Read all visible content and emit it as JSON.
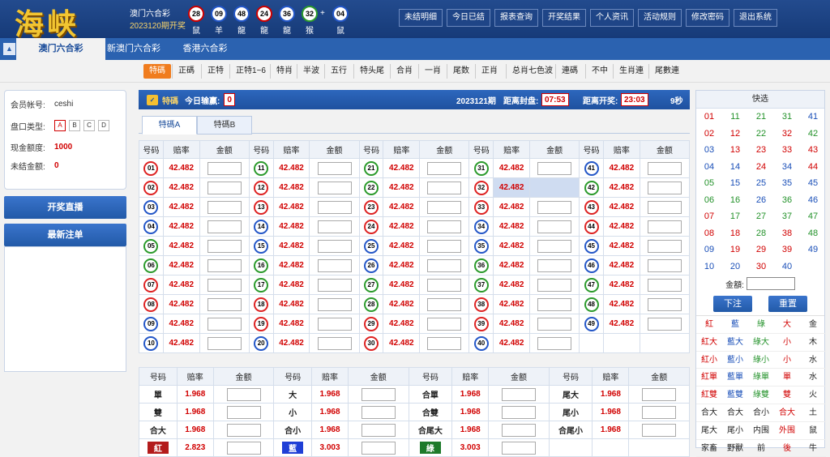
{
  "header": {
    "logo": "海峡",
    "lottery": "澳门六合彩",
    "issue": "2023120期开奖",
    "plus": "+",
    "balls": [
      {
        "n": "28",
        "z": "鼠",
        "c": "r"
      },
      {
        "n": "09",
        "z": "羊",
        "c": "u"
      },
      {
        "n": "48",
        "z": "龍",
        "c": "u"
      },
      {
        "n": "24",
        "z": "龍",
        "c": "r"
      },
      {
        "n": "36",
        "z": "龍",
        "c": "u"
      },
      {
        "n": "32",
        "z": "猴",
        "c": "g"
      },
      {
        "n": "04",
        "z": "鼠",
        "c": "u"
      }
    ],
    "nav": [
      "未结明细",
      "今日已结",
      "报表查询",
      "开奖结果",
      "个人资讯",
      "活动规则",
      "修改密码",
      "退出系统"
    ]
  },
  "tabs": [
    "澳门六合彩",
    "新澳门六合彩",
    "香港六合彩"
  ],
  "subnav": [
    "特碼",
    "正碼",
    "正特",
    "正特1~6",
    "特肖",
    "半波",
    "五行",
    "特头尾",
    "合肖",
    "一肖",
    "尾数",
    "正肖",
    "总肖七色波",
    "連碼",
    "不中",
    "生肖連",
    "尾數連"
  ],
  "account": {
    "user_label": "会员帐号:",
    "user": "ceshi",
    "pan_label": "盘口类型:",
    "pans": [
      "A",
      "B",
      "C",
      "D"
    ],
    "cash_label": "现金额度:",
    "cash": "1000",
    "unsettled_label": "未结金额:",
    "unsettled": "0"
  },
  "sidebar": {
    "live": "开奖直播",
    "latest": "最新注单"
  },
  "info": {
    "title": "特碼",
    "today_label": "今日输赢:",
    "today": "0",
    "period": "2023121期",
    "close_label": "距离封盘:",
    "close": "07:53",
    "open_label": "距离开奖:",
    "open": "23:03",
    "refresh": "9秒"
  },
  "subtabs": [
    "特碼A",
    "特碼B"
  ],
  "grid": {
    "h_num": "号码",
    "h_odds": "赔率",
    "h_amt": "金额",
    "odds": "42.482",
    "colors": [
      "r",
      "r",
      "u",
      "u",
      "g",
      "g",
      "r",
      "r",
      "u",
      "u",
      "g",
      "r",
      "r",
      "u",
      "u",
      "g",
      "g",
      "r",
      "r",
      "u",
      "g",
      "g",
      "r",
      "r",
      "u",
      "u",
      "g",
      "g",
      "r",
      "r",
      "g",
      "r",
      "r",
      "u",
      "u",
      "g",
      "g",
      "r",
      "r",
      "u",
      "u",
      "g",
      "r",
      "r",
      "u",
      "u",
      "g",
      "g",
      "u"
    ]
  },
  "grid2": {
    "rows": [
      [
        "單",
        "1.968",
        "大",
        "1.968",
        "合單",
        "1.968",
        "尾大",
        "1.968"
      ],
      [
        "雙",
        "1.968",
        "小",
        "1.968",
        "合雙",
        "1.968",
        "尾小",
        "1.968"
      ],
      [
        "合大",
        "1.968",
        "合小",
        "1.968",
        "合尾大",
        "1.968",
        "合尾小",
        "1.968"
      ],
      [
        "紅",
        "2.823",
        "藍",
        "3.003",
        "綠",
        "3.003",
        "",
        ""
      ]
    ]
  },
  "quick": {
    "title": "快选",
    "amount_label": "金額:",
    "submit": "下注",
    "reset": "重置",
    "zodiac": [
      [
        "紅",
        "藍",
        "綠",
        "大",
        "金"
      ],
      [
        "紅大",
        "藍大",
        "綠大",
        "小",
        "木"
      ],
      [
        "紅小",
        "藍小",
        "綠小",
        "小",
        "水"
      ],
      [
        "紅單",
        "藍單",
        "綠單",
        "單",
        "水"
      ],
      [
        "紅雙",
        "藍雙",
        "綠雙",
        "雙",
        "火"
      ],
      [
        "合大",
        "合大",
        "合小",
        "合大",
        "土"
      ],
      [
        "尾大",
        "尾小",
        "内围",
        "外围",
        "鼠"
      ],
      [
        "家畜",
        "野獸",
        "前",
        "後",
        "牛"
      ]
    ]
  }
}
